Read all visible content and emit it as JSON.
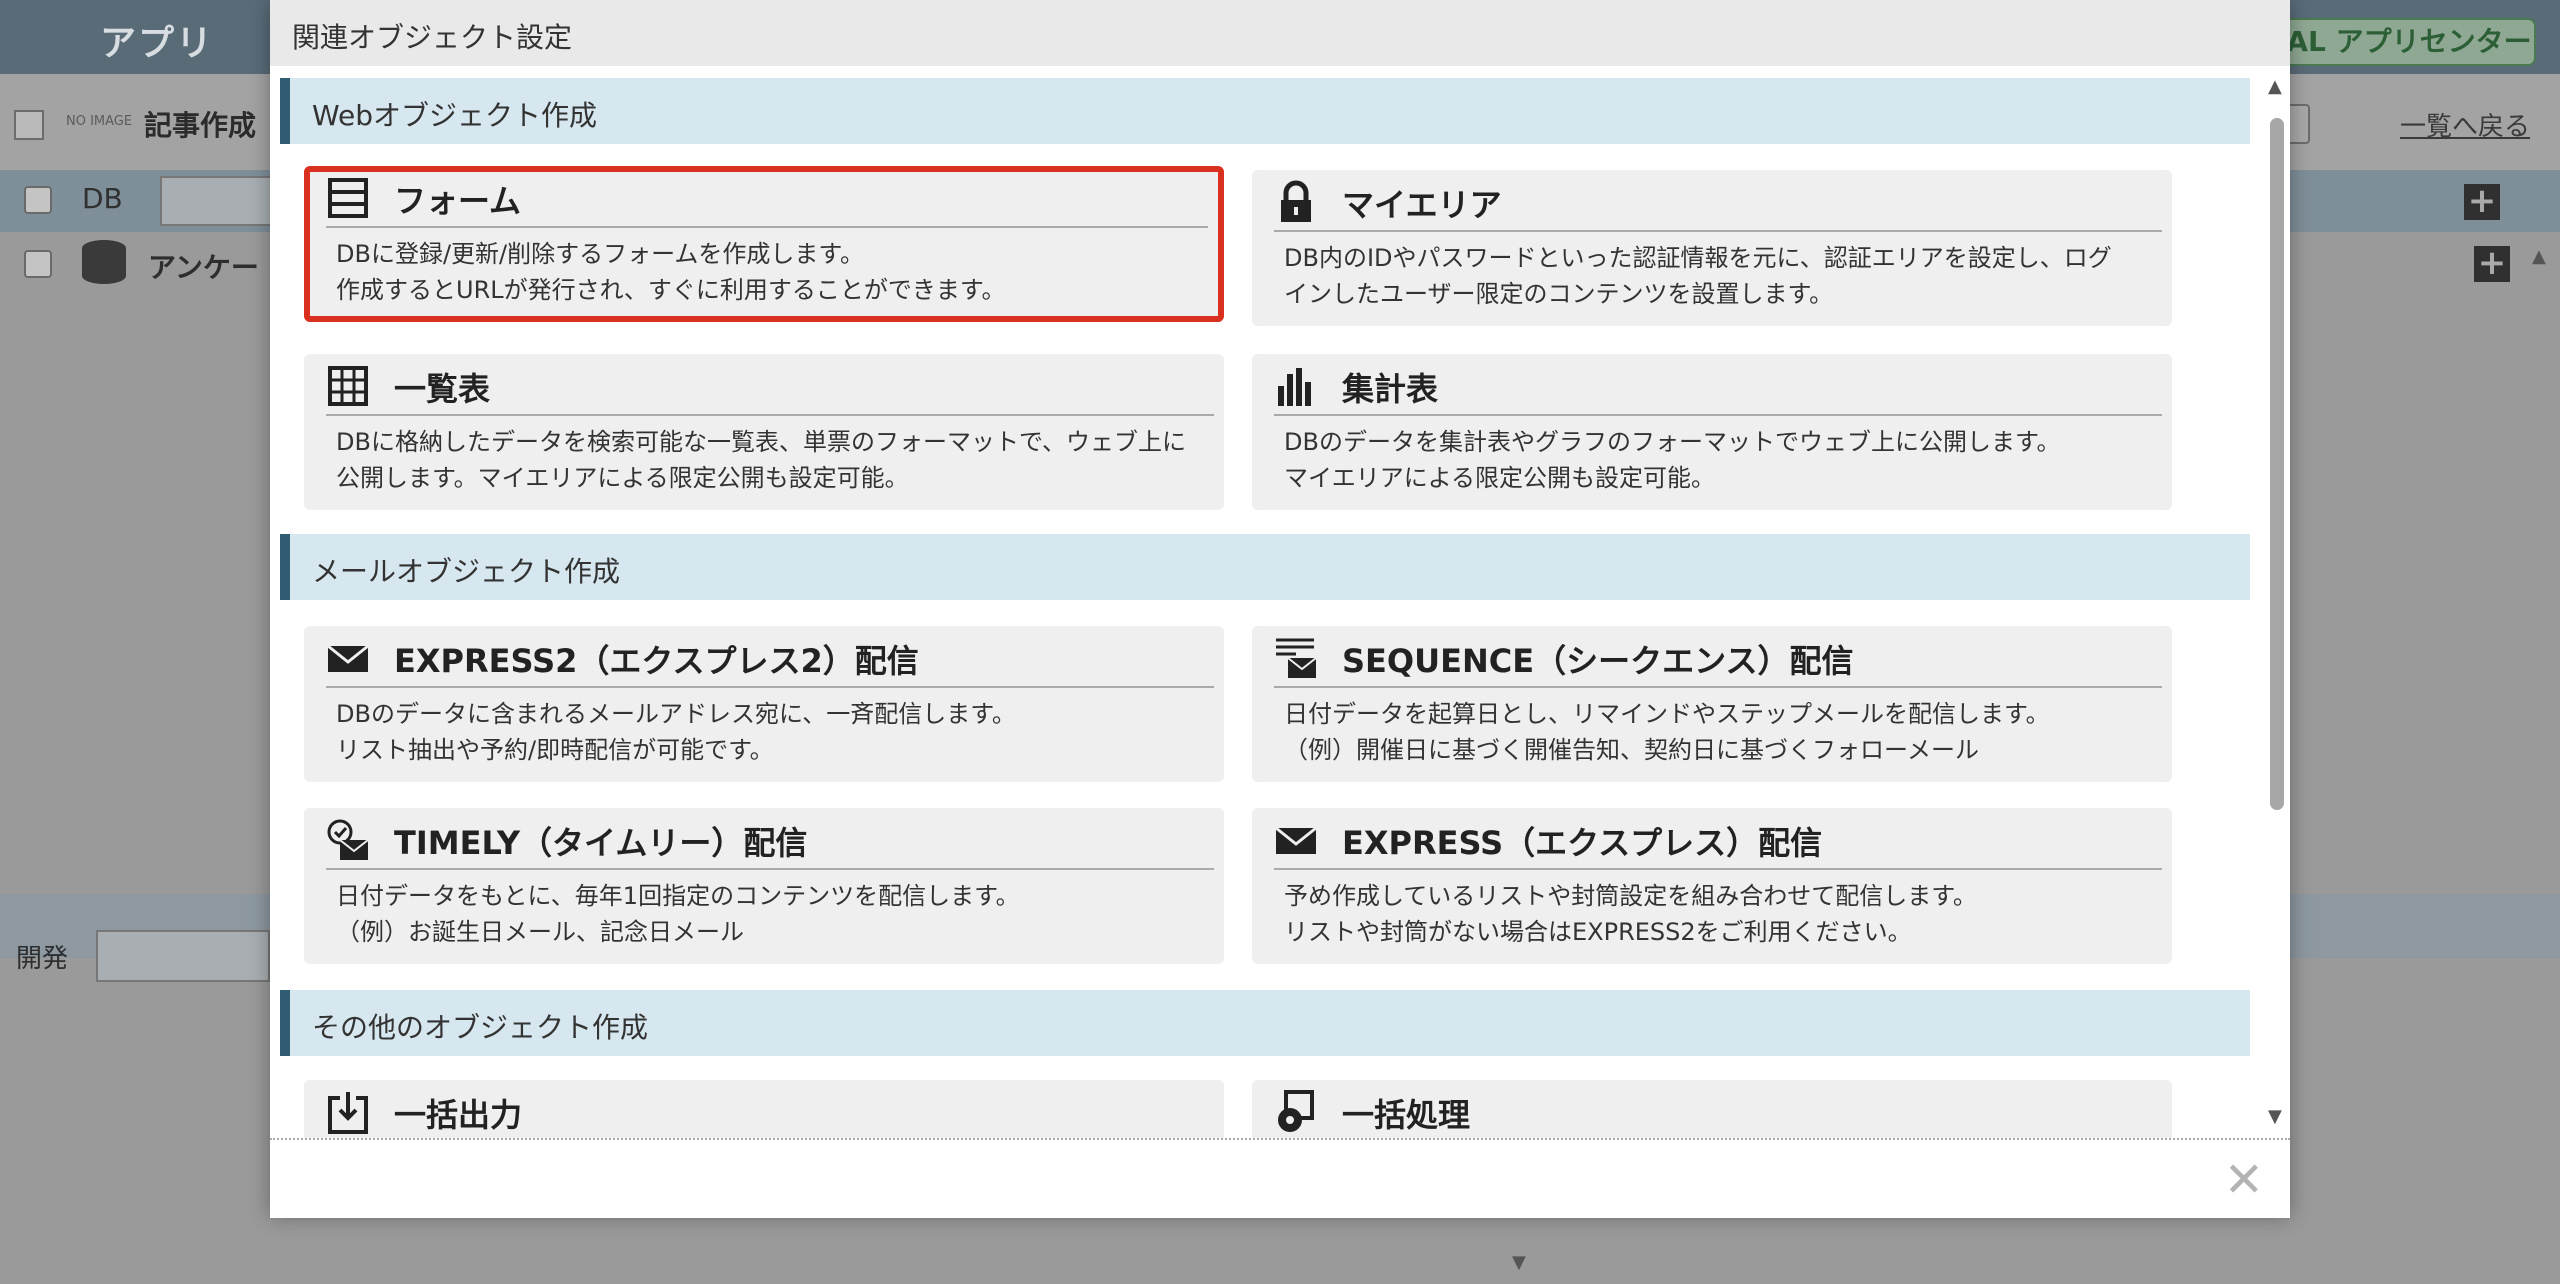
{
  "background": {
    "app_title": "アプリ",
    "logo_text": "AL アプリセンター",
    "noimage_label": "NO IMAGE",
    "article_title": "記事作成",
    "back_link": "一覧へ戻る",
    "db_label": "DB",
    "db_item": "アンケー",
    "dev_label": "開発"
  },
  "modal": {
    "title": "関連オブジェクト設定",
    "close_label": "✕",
    "sections": [
      {
        "label": "Webオブジェクト作成"
      },
      {
        "label": "メールオブジェクト作成"
      },
      {
        "label": "その他のオブジェクト作成"
      }
    ],
    "cards": [
      {
        "title": "フォーム",
        "icon": "form-icon",
        "lines": [
          "DBに登録/更新/削除するフォームを作成します。",
          "作成するとURLが発行され、すぐに利用することができます。"
        ]
      },
      {
        "title": "マイエリア",
        "icon": "lock-icon",
        "lines": [
          "DB内のIDやパスワードといった認証情報を元に、認証エリアを設定し、ログ",
          "インしたユーザー限定のコンテンツを設置します。"
        ]
      },
      {
        "title": "一覧表",
        "icon": "table-icon",
        "lines": [
          "DBに格納したデータを検索可能な一覧表、単票のフォーマットで、ウェブ上に",
          "公開します。マイエリアによる限定公開も設定可能。"
        ]
      },
      {
        "title": "集計表",
        "icon": "bar-chart-icon",
        "lines": [
          "DBのデータを集計表やグラフのフォーマットでウェブ上に公開します。",
          "マイエリアによる限定公開も設定可能。"
        ]
      },
      {
        "title": "EXPRESS2（エクスプレス2）配信",
        "icon": "mail-icon",
        "lines": [
          "DBのデータに含まれるメールアドレス宛に、一斉配信します。",
          "リスト抽出や予約/即時配信が可能です。"
        ]
      },
      {
        "title": "SEQUENCE（シークエンス）配信",
        "icon": "sequence-mail-icon",
        "lines": [
          "日付データを起算日とし、リマインドやステップメールを配信します。",
          "（例）開催日に基づく開催告知、契約日に基づくフォローメール"
        ]
      },
      {
        "title": "TIMELY（タイムリー）配信",
        "icon": "timely-mail-icon",
        "lines": [
          "日付データをもとに、毎年1回指定のコンテンツを配信します。",
          "（例）お誕生日メール、記念日メール"
        ]
      },
      {
        "title": "EXPRESS（エクスプレス）配信",
        "icon": "mail-icon",
        "lines": [
          "予め作成しているリストや封筒設定を組み合わせて配信します。",
          "リストや封筒がない場合はEXPRESS2をご利用ください。"
        ]
      },
      {
        "title": "一括出力",
        "icon": "export-icon",
        "lines": []
      },
      {
        "title": "一括処理",
        "icon": "batch-gear-icon",
        "lines": []
      }
    ]
  }
}
